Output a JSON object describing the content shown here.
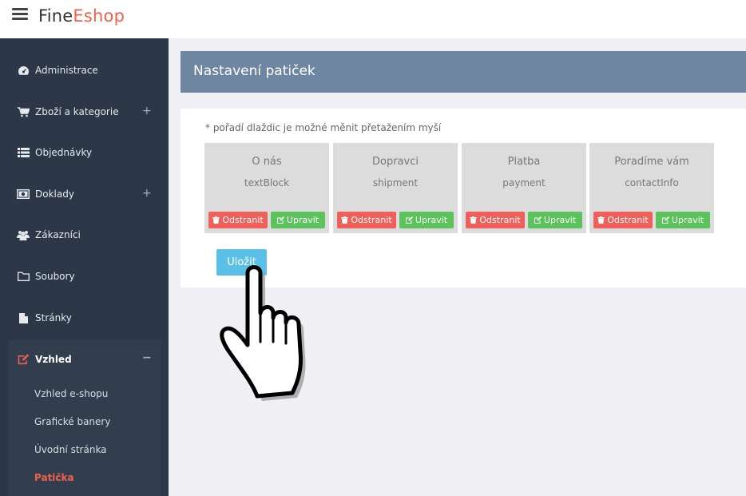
{
  "app": {
    "logo_part1": "Fine",
    "logo_part2": "Eshop"
  },
  "sidebar": {
    "items": [
      {
        "label": "Administrace",
        "icon": "dashboard-icon"
      },
      {
        "label": "Zboží a kategorie",
        "icon": "cart-icon",
        "expand": "+"
      },
      {
        "label": "Objednávky",
        "icon": "list-icon"
      },
      {
        "label": "Doklady",
        "icon": "money-icon",
        "expand": "+"
      },
      {
        "label": "Zákazníci",
        "icon": "users-icon"
      },
      {
        "label": "Soubory",
        "icon": "folder-icon"
      },
      {
        "label": "Stránky",
        "icon": "file-icon"
      },
      {
        "label": "Vzhled",
        "icon": "edit-icon",
        "expand": "−"
      }
    ],
    "subitems": [
      "Vzhled e-shopu",
      "Grafické banery",
      "Úvodní stránka",
      "Patička"
    ]
  },
  "page": {
    "title": "Nastavení patiček",
    "hint": "* pořadí dlaždic je možné měnit přetažením myší",
    "save_label": "Uložit"
  },
  "tiles": [
    {
      "title": "O nás",
      "type": "textBlock",
      "delete_label": "Odstranit",
      "edit_label": "Upravit"
    },
    {
      "title": "Dopravci",
      "type": "shipment",
      "delete_label": "Odstranit",
      "edit_label": "Upravit"
    },
    {
      "title": "Platba",
      "type": "payment",
      "delete_label": "Odstranit",
      "edit_label": "Upravit"
    },
    {
      "title": "Poradíme vám",
      "type": "contactInfo",
      "delete_label": "Odstranit",
      "edit_label": "Upravit"
    }
  ],
  "colors": {
    "accent": "#f0604c",
    "sidebar": "#2c3848",
    "header": "#6f86a3",
    "delete": "#f0605a",
    "edit": "#5cc25b",
    "save": "#5bc0e8"
  }
}
